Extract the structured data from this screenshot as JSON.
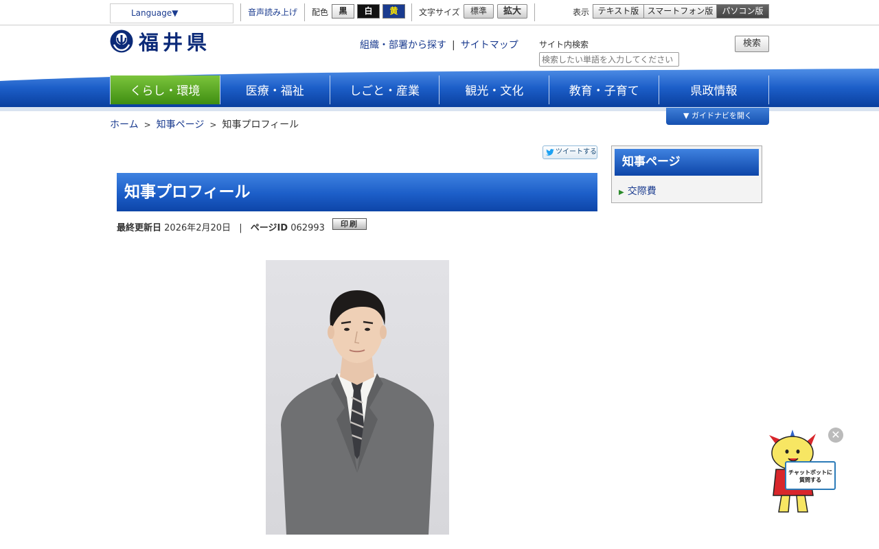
{
  "topbar": {
    "language_label": "Language▼",
    "voice_read": "音声読み上げ",
    "color_label": "配色",
    "color_options": [
      "黒",
      "白",
      "黄"
    ],
    "font_size_label": "文字サイズ",
    "font_standard": "標準",
    "font_large": "拡大",
    "display_label": "表示",
    "display_options": [
      "テキスト版",
      "スマートフォン版",
      "パソコン版"
    ]
  },
  "header": {
    "logo_text": "福井県",
    "link_org": "組織・部署から探す",
    "link_sep": "|",
    "link_sitemap": "サイトマップ",
    "search_label": "サイト内検索",
    "search_placeholder": "検索したい単語を入力してください",
    "search_button": "検索"
  },
  "nav": {
    "items": [
      "くらし・環境",
      "医療・福祉",
      "しごと・産業",
      "観光・文化",
      "教育・子育て",
      "県政情報"
    ],
    "guide_button": "▼ ガイドナビを開く"
  },
  "breadcrumb": {
    "home": "ホーム",
    "governor_page": "知事ページ",
    "current": "知事プロフィール",
    "sep": ">"
  },
  "main": {
    "tweet_label": "ツイートする",
    "title": "知事プロフィール",
    "updated_label": "最終更新日",
    "updated_value": "2026年2月20日",
    "meta_sep": "|",
    "page_id_label": "ページID",
    "page_id_value": "062993",
    "print_label": "印刷"
  },
  "side": {
    "heading": "知事ページ",
    "items": [
      "交際費"
    ]
  },
  "chatbot": {
    "bubble_line1": "チャットボットに",
    "bubble_line2": "質問する"
  },
  "colors": {
    "nav_blue": "#1c5ec8",
    "nav_active_green": "#4f9e1c",
    "link_blue": "#1a3b8f"
  }
}
